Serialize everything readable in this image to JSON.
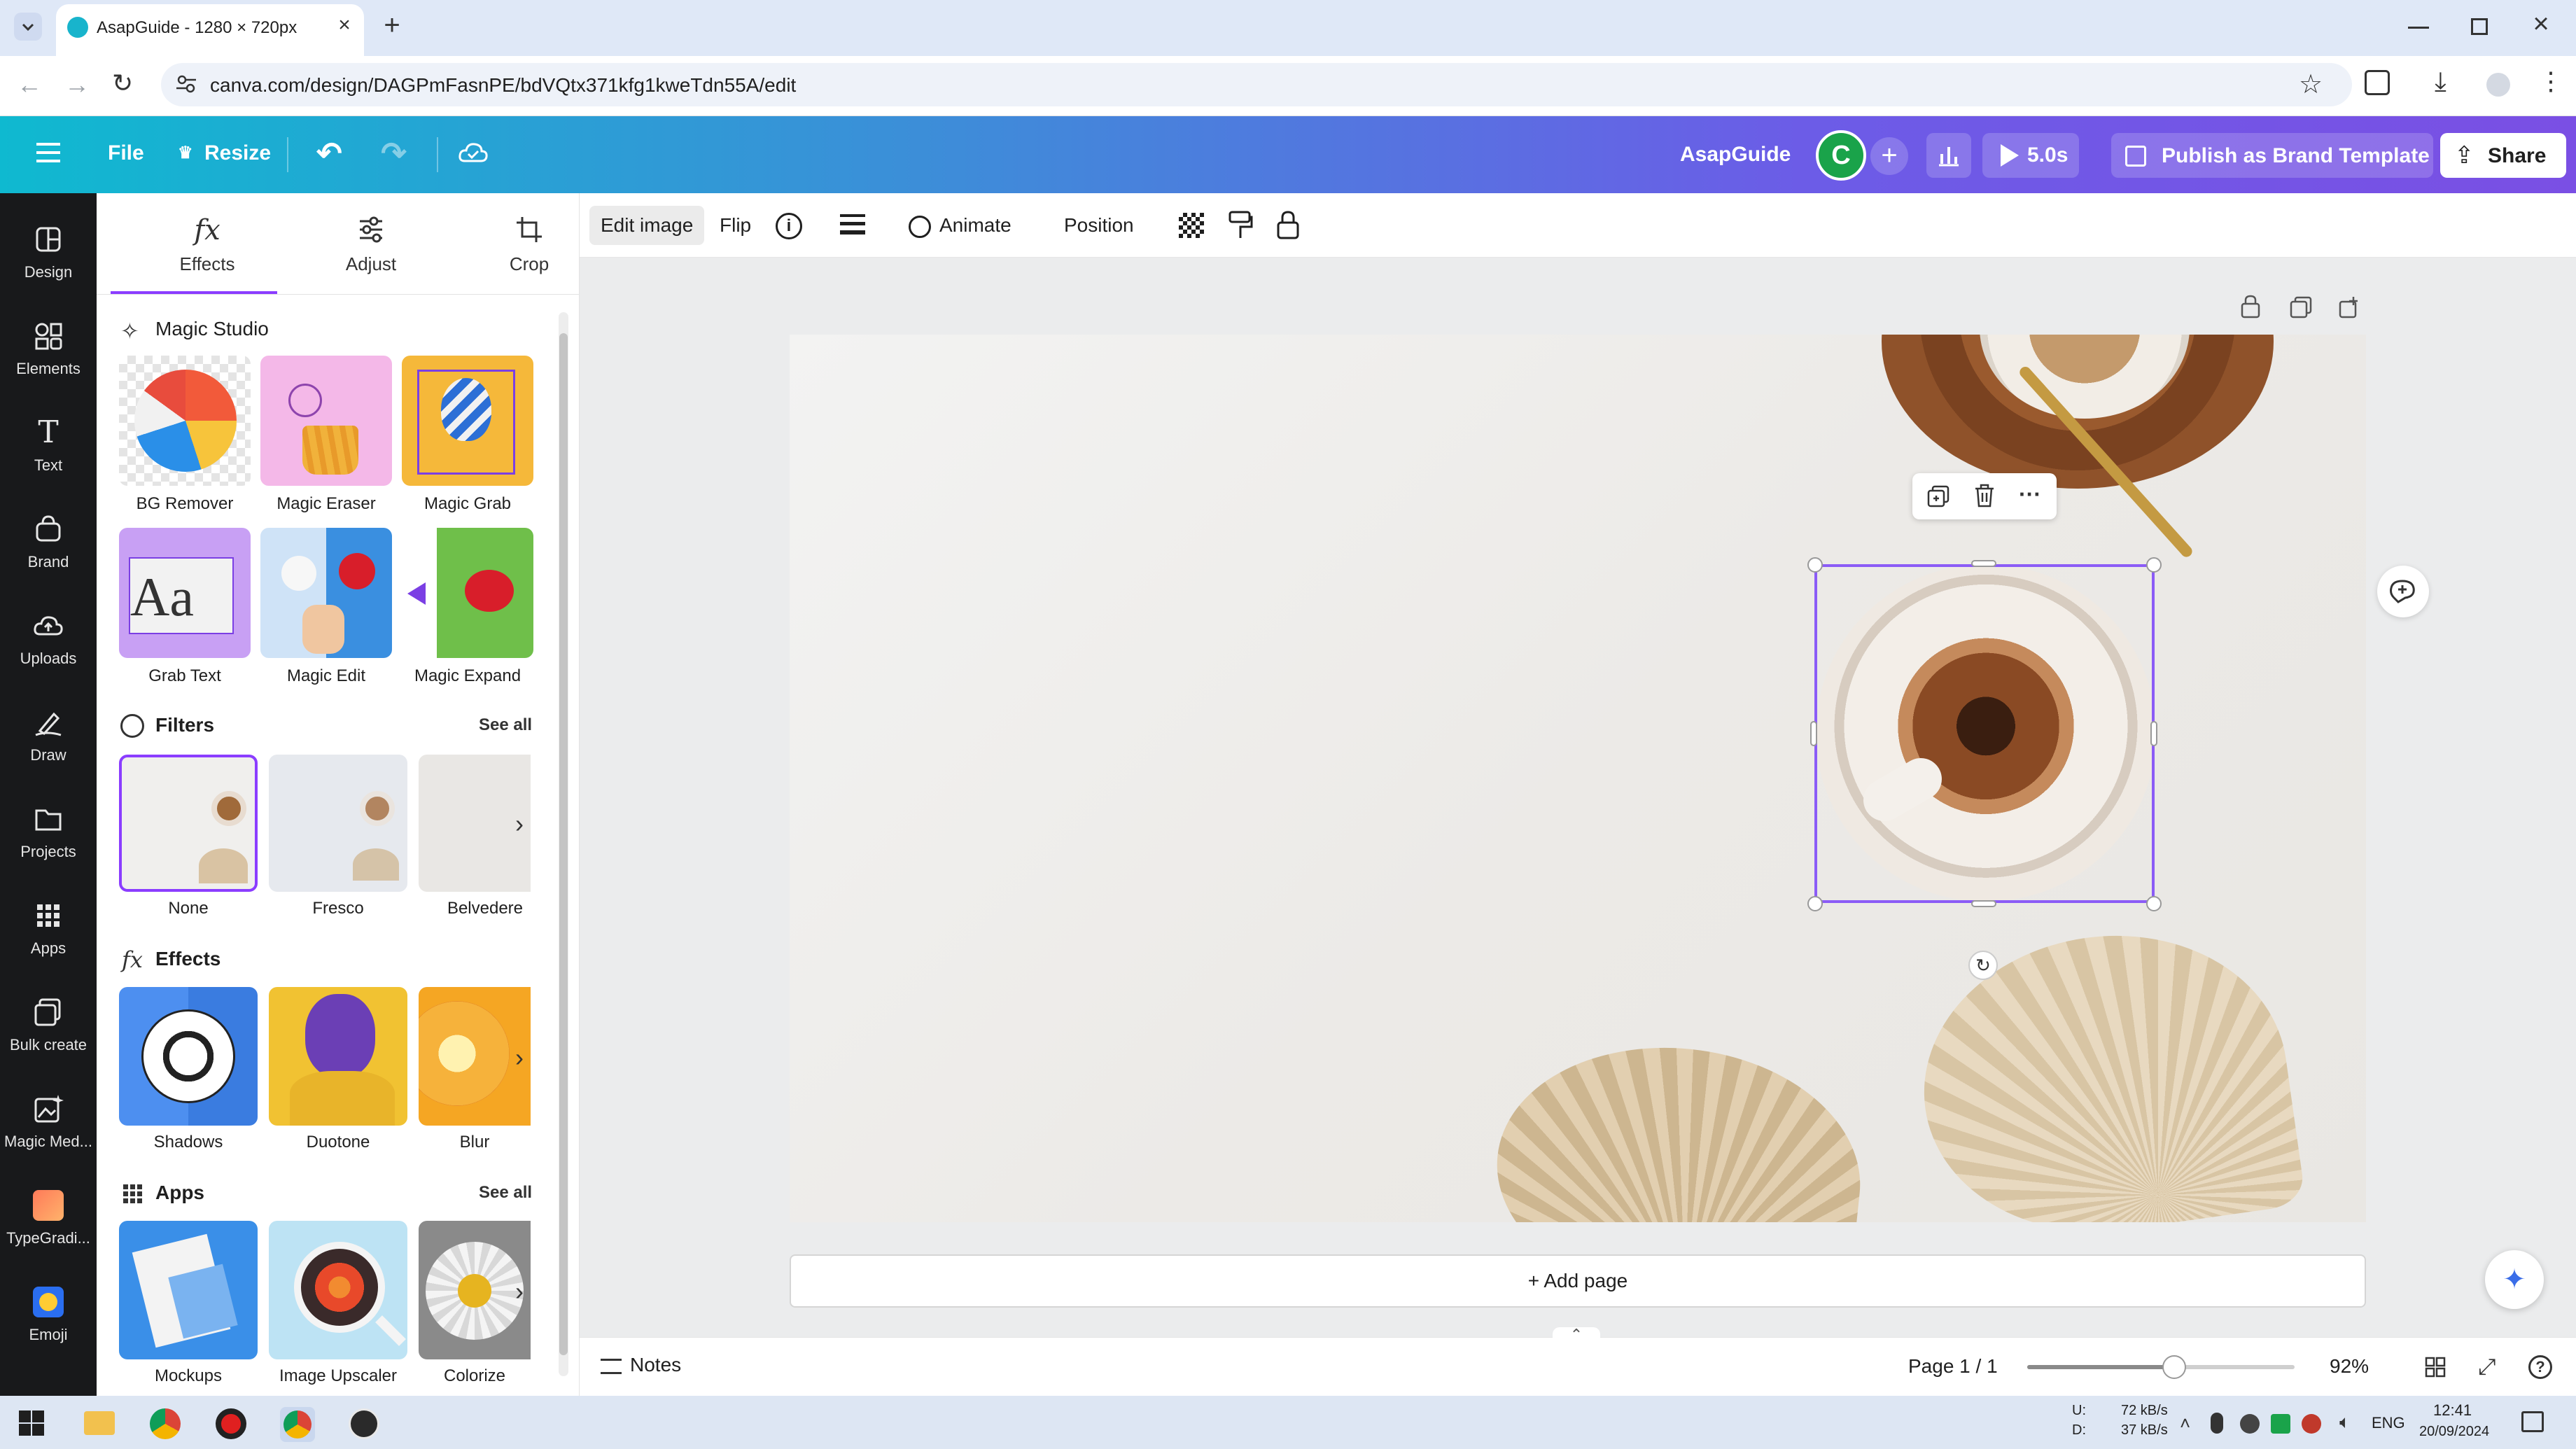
{
  "browser": {
    "tab_title": "AsapGuide - 1280 × 720px",
    "url": "canva.com/design/DAGPmFasnPE/bdVQtx371kfg1kweTdn55A/edit"
  },
  "topbar": {
    "file": "File",
    "resize": "Resize",
    "design_name": "AsapGuide",
    "avatar_letter": "C",
    "play_duration": "5.0s",
    "publish": "Publish as Brand Template",
    "share": "Share"
  },
  "rail": [
    {
      "label": "Design"
    },
    {
      "label": "Elements"
    },
    {
      "label": "Text"
    },
    {
      "label": "Brand"
    },
    {
      "label": "Uploads"
    },
    {
      "label": "Draw"
    },
    {
      "label": "Projects"
    },
    {
      "label": "Apps"
    },
    {
      "label": "Bulk create"
    },
    {
      "label": "Magic Med..."
    },
    {
      "label": "TypeGradi..."
    },
    {
      "label": "Emoji"
    }
  ],
  "panel": {
    "tabs": [
      "Effects",
      "Adjust",
      "Crop"
    ],
    "magic_studio": {
      "title": "Magic Studio",
      "items": [
        "BG Remover",
        "Magic Eraser",
        "Magic Grab",
        "Grab Text",
        "Magic Edit",
        "Magic Expand"
      ]
    },
    "filters": {
      "title": "Filters",
      "see_all": "See all",
      "items": [
        "None",
        "Fresco",
        "Belvedere"
      ]
    },
    "effects": {
      "title": "Effects",
      "items": [
        "Shadows",
        "Duotone",
        "Blur"
      ]
    },
    "apps": {
      "title": "Apps",
      "see_all": "See all",
      "items": [
        "Mockups",
        "Image Upscaler",
        "Colorize"
      ]
    }
  },
  "toolbar": {
    "edit_image": "Edit image",
    "flip": "Flip",
    "animate": "Animate",
    "position": "Position"
  },
  "canvas": {
    "add_page": "+ Add page"
  },
  "bottom": {
    "notes": "Notes",
    "page": "Page 1 / 1",
    "zoom": "92%",
    "zoom_level": 0.55
  },
  "taskbar": {
    "net_up": "U:",
    "net_down": "D:",
    "up_speed": "72 kB/s",
    "down_speed": "37 kB/s",
    "lang": "ENG",
    "time": "12:41",
    "date": "20/09/2024"
  },
  "colors": {
    "accent": "#8b3dff",
    "selection": "#8b5cf6",
    "rail_bg": "#18191b"
  }
}
